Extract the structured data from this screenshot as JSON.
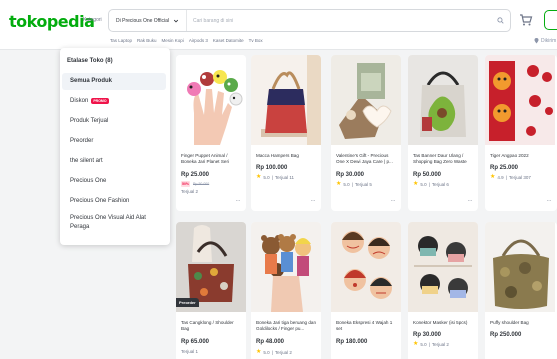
{
  "header": {
    "logo": "tokopedia",
    "kategori": "Kategori",
    "store_select": "Di Precious One Official",
    "search_placeholder": "Cari barang di sini",
    "location": "Dikirim",
    "quick_links": [
      "Tas Laptop",
      "Rak Buku",
      "Mesin Kopi",
      "Airpods 3",
      "Kaset Datomite",
      "Tv Box"
    ]
  },
  "menu": {
    "title": "Etalase Toko (8)",
    "items": [
      {
        "label": "Semua Produk",
        "active": true
      },
      {
        "label": "Diskon",
        "badge": "PROMO"
      },
      {
        "label": "Produk Terjual"
      },
      {
        "label": "Preorder"
      },
      {
        "label": "the silent art"
      },
      {
        "label": "Precious One"
      },
      {
        "label": "Precious One Fashion"
      },
      {
        "label": "Precious One Visual Aid Alat Peraga"
      }
    ]
  },
  "products_row1": [
    {
      "name": "Finger Puppet Animal / Boneka Jari Planet Seri Binat...",
      "price": "Rp 25.000",
      "discount": "50%",
      "old_price": "Rp 50.000",
      "sold": "Terjual 2"
    },
    {
      "name": "Macca Hampers Bag",
      "price": "Rp 100.000",
      "rating": "5.0",
      "sold": "Terjual 11"
    },
    {
      "name": "Valentine's Gift - Precious One X Dewi Jaya Care | p...",
      "price": "Rp 30.000",
      "rating": "5.0",
      "sold": "Terjual 5"
    },
    {
      "name": "Tas Banner Daur Ulang / Shopping Bag Zero Waste",
      "price": "Rp 50.000",
      "rating": "5.0",
      "sold": "Terjual 6"
    },
    {
      "name": "Tiger Angpao 2022",
      "price": "Rp 25.000",
      "rating": "4.9",
      "sold": "Terjual 307"
    }
  ],
  "products_row2": [
    {
      "name": "Tas Cangklong / Shoulder Bag",
      "price": "Rp 65.000",
      "sold": "Terjual 1",
      "preorder": "Preorder"
    },
    {
      "name": "Boneka Jari tiga beruang dan Goldilocks / Finger pu...",
      "price": "Rp 48.000",
      "rating": "5.0",
      "sold": "Terjual 2"
    },
    {
      "name": "Boneka Ekspresi 4 Wajah 1 set",
      "price": "Rp 180.000"
    },
    {
      "name": "Konektor Masker (isi 5pcs)",
      "price": "Rp 30.000",
      "rating": "5.0",
      "sold": "Terjual 2"
    },
    {
      "name": "Puffy shoulder Bag",
      "price": "Rp 250.000"
    }
  ],
  "colors": {
    "brand": "#03ac0e",
    "promo": "#ef144a",
    "star": "#ffc400"
  }
}
